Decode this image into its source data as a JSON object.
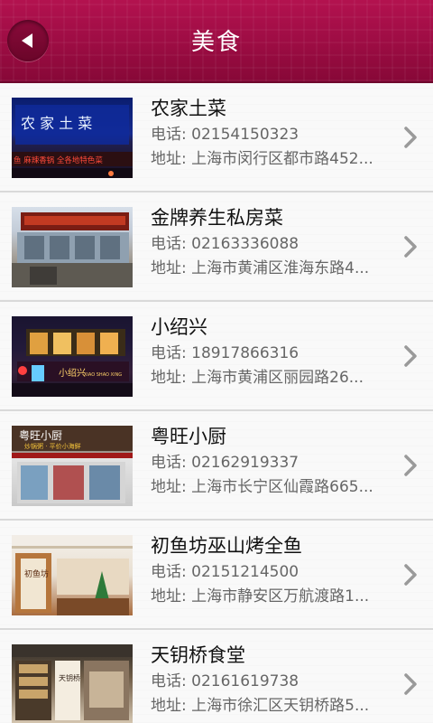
{
  "header": {
    "title": "美食",
    "back_icon": "back-arrow-icon"
  },
  "colors": {
    "header": "#9c0c43",
    "chevron": "#9a9a9a"
  },
  "restaurants": [
    {
      "name": "农家土菜",
      "phone": "电话: 02154150323",
      "address": "地址: 上海市闵行区都市路452..."
    },
    {
      "name": "金牌养生私房菜",
      "phone": "电话: 02163336088",
      "address": "地址: 上海市黄浦区淮海东路4..."
    },
    {
      "name": "小绍兴",
      "phone": "电话: 18917866316",
      "address": "地址: 上海市黄浦区丽园路26..."
    },
    {
      "name": "粤旺小厨",
      "phone": "电话: 02162919337",
      "address": "地址: 上海市长宁区仙霞路665..."
    },
    {
      "name": "初鱼坊巫山烤全鱼",
      "phone": "电话: 02151214500",
      "address": "地址: 上海市静安区万航渡路1..."
    },
    {
      "name": "天钥桥食堂",
      "phone": "电话: 02161619738",
      "address": "地址: 上海市徐汇区天钥桥路5..."
    }
  ],
  "signage": {
    "r1_main": "农 家 土 菜",
    "r1_sub": "鱼 麻辣香锅 全各地特色菜",
    "r3_sign": "小绍兴",
    "r3_sub": "XIAO SHAO XING",
    "r4_sign": "粤旺小厨",
    "r4_sub": "炒锅粥 · 平价小海鲜",
    "r5_sign": "初鱼坊",
    "r6_sign": "天钥桥"
  }
}
